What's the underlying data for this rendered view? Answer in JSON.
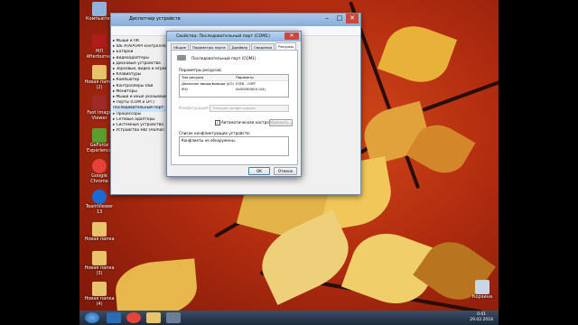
{
  "desktop": {
    "icons": [
      {
        "label": "Компьютер",
        "color": "#8fb3dc"
      },
      {
        "label": "МЛ Afterburner",
        "color": "#b01b1b"
      },
      {
        "label": "Новая папка (2)",
        "color": "#e7c36b"
      },
      {
        "label": "Fast Image Viewer",
        "color": "#9e2a2a"
      },
      {
        "label": "GeForce Experience",
        "color": "#5a9e2f"
      },
      {
        "label": "Google Chrome",
        "color": "#e5433a"
      },
      {
        "label": "TeamViewer 13",
        "color": "#1a6bd6"
      },
      {
        "label": "Новая папка",
        "color": "#e7c36b"
      },
      {
        "label": "Новая папка (3)",
        "color": "#e7c36b"
      },
      {
        "label": "Новая папка (4)",
        "color": "#e7c36b"
      }
    ],
    "recycle_bin": "Корзина"
  },
  "explorer": {
    "title": "Диспетчер устройств",
    "tree": [
      "▸ Мыши и ПК",
      "▸ IDE ATA/ATAPI контроллеры",
      "▸ Батареи",
      "▸ Видеоадаптеры",
      "▸ Дисковые устройства",
      "▸ Звуковые, видео и игровые",
      "▸ Клавиатуры",
      "▸ Компьютер",
      "▸ Контроллеры USB",
      "▸ Мониторы",
      "▸ Мыши и иные указывающие",
      "▾ Порты (COM и LPT)",
      "   Последовательный порт",
      "▸ Процессоры",
      "▸ Сетевые адаптеры",
      "▸ Системные устройства",
      "▸ Устройства HID (Human"
    ]
  },
  "dialog": {
    "title": "Свойства: Последовательный порт (COM1)",
    "tabs": [
      "Общие",
      "Параметры порта",
      "Драйвер",
      "Сведения",
      "Ресурсы"
    ],
    "active_tab": "Ресурсы",
    "device_name": "Последовательный порт (COM1)",
    "resource_settings_label": "Параметры ресурсов:",
    "table_headers": [
      "Тип ресурса",
      "Параметр"
    ],
    "table_rows": [
      [
        "Диапазон ввода/вывода (I/O)",
        "03F8 - 03FF"
      ],
      [
        "IRQ",
        "0x00000004 (04)"
      ]
    ],
    "config_label": "Конфигурация:",
    "config_value": "Текущая конфигурация",
    "auto_setting_label": "Автоматическая настройка",
    "change_button": "Изменить...",
    "conflict_label": "Список конфликтующих устройств:",
    "conflict_text": "Конфликты не обнаружены.",
    "ok_button": "ОК",
    "cancel_button": "Отмена"
  },
  "taskbar": {
    "time": "0:01",
    "date": "29.02.2018"
  }
}
